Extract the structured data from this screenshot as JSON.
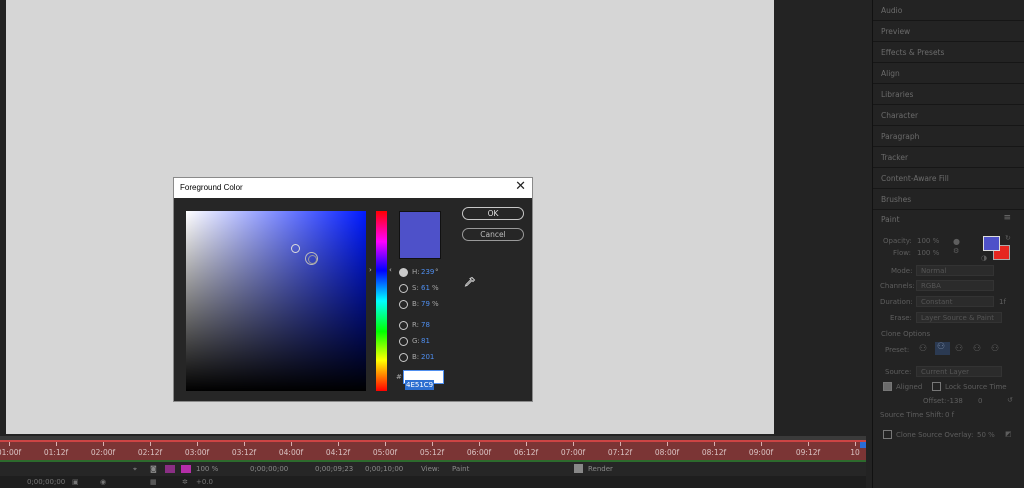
{
  "timeline": {
    "ticks": [
      "01:00f",
      "01:12f",
      "02:00f",
      "02:12f",
      "03:00f",
      "03:12f",
      "04:00f",
      "04:12f",
      "05:00f",
      "05:12f",
      "06:00f",
      "06:12f",
      "07:00f",
      "07:12f",
      "08:00f",
      "08:12f",
      "09:00f",
      "09:12f",
      "10"
    ],
    "zoom": "100 %",
    "time_start": "0;00;00;00",
    "time_end": "0;00;09;23",
    "duration": "0;00;10;00",
    "view_label": "View:",
    "view_value": "Paint",
    "render_label": "Render",
    "time_current": "0;00;00;00",
    "exposure": "+0.0",
    "layer_color": "#b42ea8"
  },
  "panel": {
    "items": [
      "Audio",
      "Preview",
      "Effects & Presets",
      "Align",
      "Libraries",
      "Character",
      "Paragraph",
      "Tracker",
      "Content-Aware Fill",
      "Brushes"
    ],
    "paint": {
      "title": "Paint",
      "menu_icon": "hamburger-menu-icon",
      "opacity_label": "Opacity:",
      "opacity_value": "100 %",
      "flow_label": "Flow:",
      "flow_value": "100 %",
      "mode_label": "Mode:",
      "mode_value": "Normal",
      "channels_label": "Channels:",
      "channels_value": "RGBA",
      "duration_label": "Duration:",
      "duration_value": "Constant",
      "duration_extra": "1f",
      "erase_label": "Erase:",
      "erase_value": "Layer Source & Paint",
      "clone_options": "Clone Options",
      "preset_label": "Preset:",
      "source_label": "Source:",
      "source_value": "Current Layer",
      "aligned_label": "Aligned",
      "lock_source_label": "Lock Source Time",
      "offset_label": "Offset:",
      "offset_x": "-138",
      "offset_y": "0",
      "source_time_shift": "Source Time Shift:",
      "source_time_value": "0 f",
      "clone_overlay_label": "Clone Source Overlay:",
      "clone_overlay_value": "50 %",
      "foreground_color": "#4e51c9",
      "background_color": "#e6261f"
    }
  },
  "dialog": {
    "title": "Foreground Color",
    "ok_label": "OK",
    "cancel_label": "Cancel",
    "h_label": "H:",
    "h_value": "239",
    "h_unit": "°",
    "s_label": "S:",
    "s_value": "61",
    "s_unit": "%",
    "b_label": "B:",
    "b_value": "79",
    "b_unit": "%",
    "r_label": "R:",
    "r_value": "78",
    "g_label": "G:",
    "g_value": "81",
    "b2_label": "B:",
    "b2_value": "201",
    "hex_value": "4E51C9",
    "color": "#4e51c9"
  }
}
